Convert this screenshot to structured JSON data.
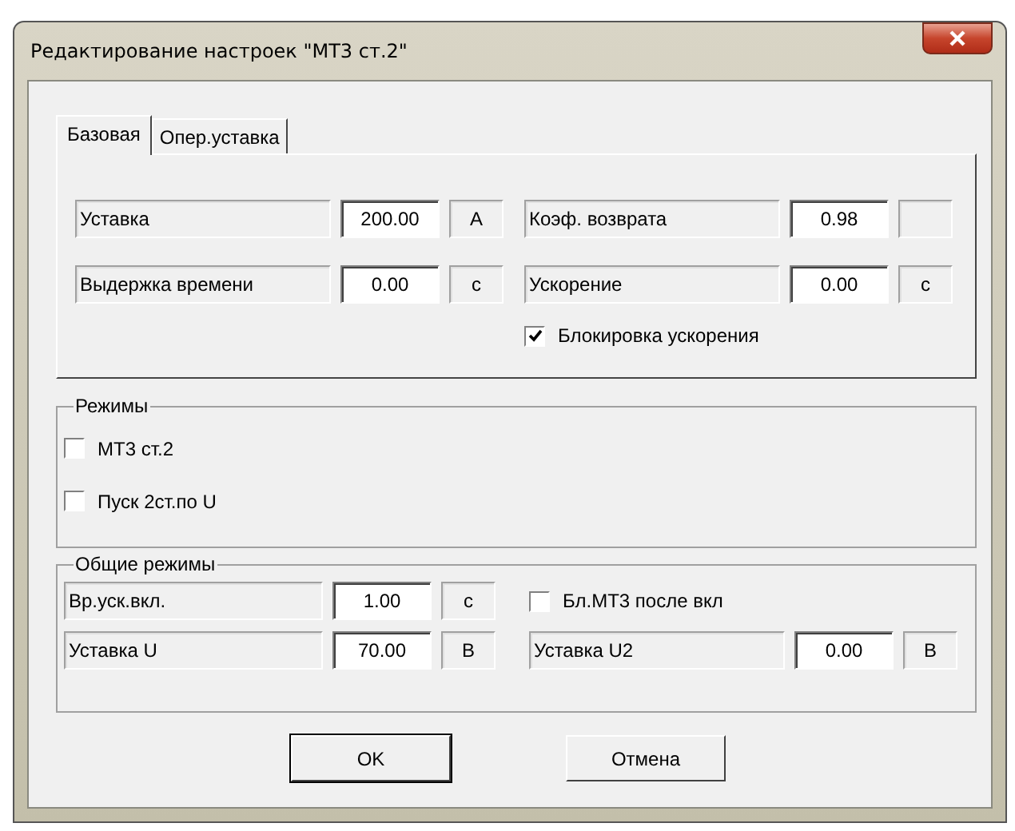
{
  "window": {
    "title": "Редактирование настроек \"МТ3 ст.2\""
  },
  "tabs": [
    {
      "label": "Базовая",
      "selected": true
    },
    {
      "label": "Опер.уставка",
      "selected": false
    }
  ],
  "base": {
    "fields": [
      {
        "label": "Уставка",
        "value": "200.00",
        "unit": "А"
      },
      {
        "label": "Коэф. возврата",
        "value": "0.98"
      },
      {
        "label": "Выдержка времени",
        "value": "0.00",
        "unit": "с"
      },
      {
        "label": "Ускорение",
        "value": "0.00",
        "unit": "с"
      }
    ],
    "checkbox": {
      "label": "Блокировка ускорения",
      "checked": true
    }
  },
  "modes": {
    "title": "Режимы",
    "checkboxes": [
      {
        "label": "МТ3 ст.2",
        "checked": false
      },
      {
        "label": "Пуск 2ст.по U",
        "checked": false
      }
    ]
  },
  "common": {
    "title": "Общие режимы",
    "items": [
      {
        "kind": "field",
        "label": "Вр.уск.вкл.",
        "value": "1.00",
        "unit": "с"
      },
      {
        "kind": "checkbox",
        "label": "Бл.МТ3 после вкл",
        "checked": false
      },
      {
        "kind": "field",
        "label": "Уставка U",
        "value": "70.00",
        "unit": "В"
      },
      {
        "kind": "field",
        "label": "Уставка U2",
        "value": "0.00",
        "unit": "В"
      }
    ]
  },
  "buttons": [
    {
      "label": "OK",
      "default": true
    },
    {
      "label": "Отмена",
      "default": false
    }
  ]
}
